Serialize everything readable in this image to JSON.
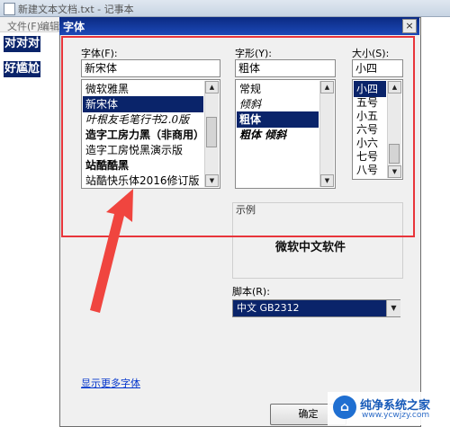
{
  "notepad": {
    "title": "新建文本文档.txt - 记事本",
    "menus": [
      "文件(F)",
      "编辑"
    ],
    "lines": [
      "对对对",
      "好尴尬"
    ]
  },
  "dialog": {
    "title": "字体",
    "close_label": "×",
    "font_label": "字体(F):",
    "font_value": "新宋体",
    "font_list": [
      "微软雅黑",
      "新宋体",
      "叶根友毛笔行书2.0版",
      "造字工房力黑（非商用）",
      "造字工房悦黑演示版",
      "站酷酷黑",
      "站酷快乐体2016修订版"
    ],
    "font_selected_index": 1,
    "style_label": "字形(Y):",
    "style_value": "粗体",
    "style_list": [
      "常规",
      "倾斜",
      "粗体",
      "粗体 倾斜"
    ],
    "style_selected_index": 2,
    "size_label": "大小(S):",
    "size_value": "小四",
    "size_list": [
      "小四",
      "五号",
      "小五",
      "六号",
      "小六",
      "七号",
      "八号"
    ],
    "size_selected_index": 0,
    "sample_label": "示例",
    "sample_text": "微软中文软件",
    "script_label": "脚本(R):",
    "script_value": "中文 GB2312",
    "more_fonts_link": "显示更多字体",
    "ok_label": "确定"
  },
  "annotation": {
    "box_color": "#e8353b",
    "arrow_color": "#f0453f"
  },
  "watermark": {
    "name": "纯净系统之家",
    "url": "www.ycwjzy.com",
    "logo_icon": "house-logo-icon"
  }
}
